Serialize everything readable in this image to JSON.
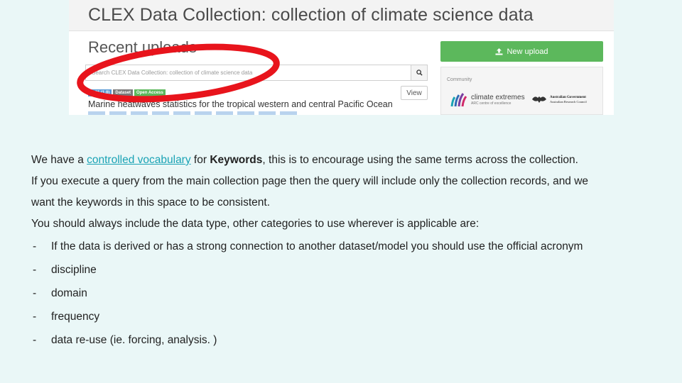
{
  "screenshot": {
    "title": "CLEX Data Collection: collection of climate science data",
    "recent_uploads": "Recent uploads",
    "search": {
      "placeholder": "Search CLEX Data Collection: collection of climate science data"
    },
    "search_icon": "search-icon",
    "badges": {
      "version": "2021 (1.0)",
      "type": "Dataset",
      "access": "Open Access"
    },
    "view_label": "View",
    "record_title": "Marine heatwaves statistics for the tropical western and central Pacific Ocean",
    "new_upload_label": "New upload",
    "new_upload_icon": "upload-icon",
    "community_label": "Community",
    "clex_logo": {
      "name": "climate extremes",
      "sub": "ARC centre of excellence"
    },
    "gov_logo": {
      "name": "Australian Government",
      "sub": "Australian Research Council"
    },
    "annotation_color": "#e8141c",
    "upload_color": "#5cb85c"
  },
  "body": {
    "p1_pre": "We have a ",
    "p1_link": "controlled vocabulary",
    "p1_mid": " for ",
    "p1_bold": "Keywords",
    "p1_post": ", this is to encourage using the same terms across the collection.",
    "p2": "If you execute a query from the main collection page then the query will include only the collection records, and we",
    "p3": "want the keywords in this space to be consistent.",
    "p4": "You should always include the data type, other categories to use wherever is applicable are:",
    "bullets": [
      "If the data is derived or has a strong connection to another dataset/model you should use the official acronym",
      "discipline",
      "domain",
      "frequency",
      "data re-use  (ie. forcing, analysis. )"
    ]
  },
  "colors": {
    "background": "#eaf7f7",
    "link": "#1aa3b5"
  }
}
